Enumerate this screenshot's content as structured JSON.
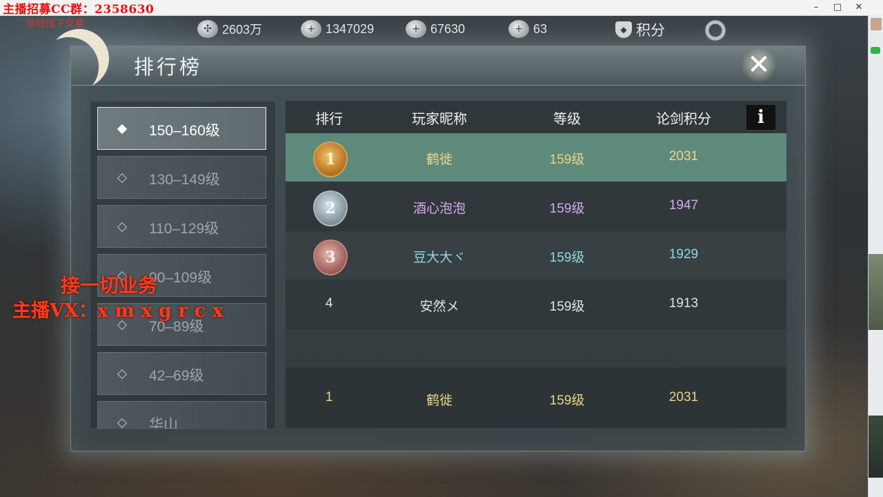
{
  "window": {
    "app_title": "接一切业务",
    "controls": {
      "minimize": "–",
      "maximize": "□",
      "close": "✕"
    }
  },
  "overlay": {
    "cc_group": "主播招募CC群：2358630",
    "trade_note": "非线线下交易",
    "ad_line1": "接一切业务",
    "ad_line2": "主播VX：x m x g r c x"
  },
  "currencies": [
    {
      "icon": "film-reel-icon",
      "value": "2603万"
    },
    {
      "icon": "silver-ingot-icon",
      "value": "1347029"
    },
    {
      "icon": "jade-ticket-icon",
      "value": "67630"
    },
    {
      "icon": "gold-ingot-icon",
      "value": "63"
    }
  ],
  "score_button": {
    "label": "积分",
    "icon": "shield-icon"
  },
  "panel": {
    "title": "排行榜",
    "close_icon": "close-icon"
  },
  "tabs": [
    {
      "label": "150–160级",
      "active": true
    },
    {
      "label": "130–149级",
      "active": false
    },
    {
      "label": "110–129级",
      "active": false
    },
    {
      "label": "90–109级",
      "active": false
    },
    {
      "label": "70–89级",
      "active": false
    },
    {
      "label": "42–69级",
      "active": false
    },
    {
      "label": "华山",
      "active": false
    }
  ],
  "table": {
    "headers": {
      "rank": "排行",
      "name": "玩家昵称",
      "level": "等级",
      "score": "论剑积分"
    },
    "info_label": "i",
    "rows": [
      {
        "rank": "1",
        "medal": "gold",
        "name": "鹤徙",
        "level": "159级",
        "score": "2031"
      },
      {
        "rank": "2",
        "medal": "silver",
        "name": "酒心泡泡",
        "level": "159级",
        "score": "1947"
      },
      {
        "rank": "3",
        "medal": "bronze",
        "name": "豆大大ヾ",
        "level": "159级",
        "score": "1929"
      },
      {
        "rank": "4",
        "medal": "",
        "name": "安然メ",
        "level": "159级",
        "score": "1913"
      }
    ],
    "my_row": {
      "rank": "1",
      "name": "鹤徙",
      "level": "159级",
      "score": "2031"
    }
  },
  "colors": {
    "highlight_row": "#5e8a7c",
    "gold_text": "#f3d68a",
    "purple_text": "#d8a8f0",
    "cyan_text": "#8fd8e2",
    "overlay_red": "#ff3a1a"
  }
}
